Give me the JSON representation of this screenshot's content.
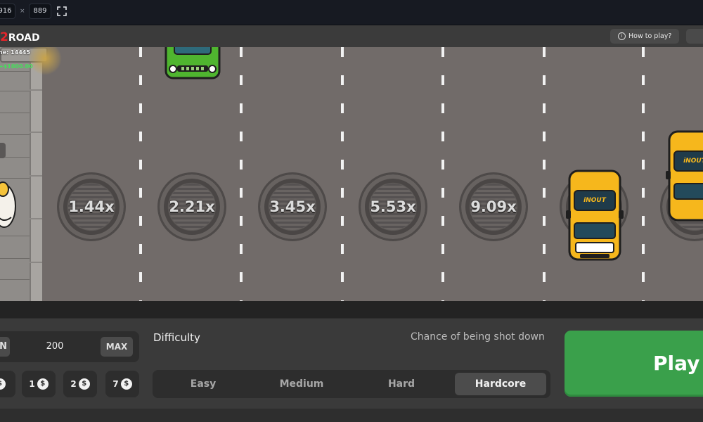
{
  "topbar": {
    "width_value": "916",
    "times": "×",
    "height_value": "889",
    "fullscreen_icon": "fullscreen-icon"
  },
  "header": {
    "logo_prefix": "2",
    "logo_text": "ROAD",
    "how_to_play": "How to play?",
    "info_icon": "i"
  },
  "player": {
    "name_label": "ne: 14445",
    "win_label": "+$1000.00"
  },
  "multipliers": [
    "1.44x",
    "2.21x",
    "3.45x",
    "5.53x",
    "9.09x"
  ],
  "cars": {
    "taxi_brand": "iNOUT"
  },
  "bet": {
    "min_label": "N",
    "value": "200",
    "max_label": "MAX",
    "chips": [
      {
        "label": ""
      },
      {
        "label": "1"
      },
      {
        "label": "2"
      },
      {
        "label": "7"
      }
    ],
    "currency_symbol": "$"
  },
  "difficulty": {
    "label": "Difficulty",
    "chance_label": "Chance of being shot down",
    "options": [
      "Easy",
      "Medium",
      "Hard",
      "Hardcore"
    ],
    "selected": "Hardcore"
  },
  "play": {
    "label": "Play"
  },
  "colors": {
    "road": "#716b69",
    "taxi": "#f6b71c",
    "green_car": "#4fb52f",
    "play_button": "#3aa04b",
    "logo_red": "#e3252b"
  }
}
